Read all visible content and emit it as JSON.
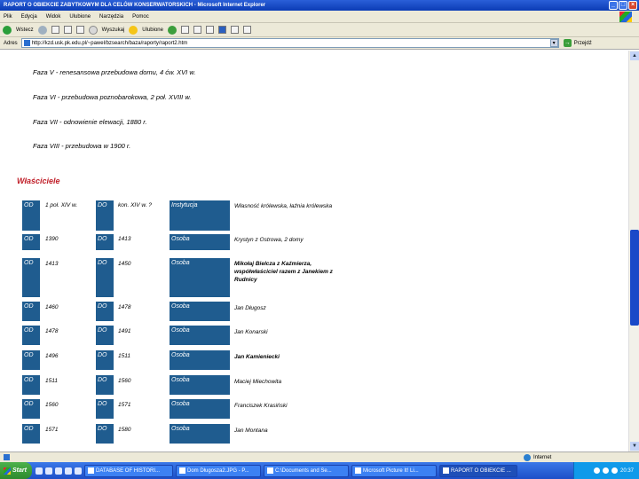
{
  "window": {
    "title": "RAPORT O OBIEKCIE ZABYTKOWYM DLA CELÓW KONSERWATORSKICH - Microsoft Internet Explorer"
  },
  "menu": [
    "Plik",
    "Edycja",
    "Widok",
    "Ulubione",
    "Narzędzia",
    "Pomoc"
  ],
  "toolbar": {
    "back": "Wstecz",
    "search": "Wyszukaj",
    "favorites": "Ulubione"
  },
  "address": {
    "label": "Adres",
    "url": "http://kzd.usk.pk.edu.pl/~pawel/bzsearch/baza/raporty/raport2.htm",
    "go": "Przejdź"
  },
  "phases": [
    "Faza V - renesansowa przebudowa domu, 4 ćw. XVI w.",
    "Faza VI - przebudowa poznobarokowa, 2 poł. XVIII w.",
    "Faza VII - odnowienie elewacji, 1880 r.",
    "Faza VIII - przebudowa w 1900 r."
  ],
  "owners_heading": "Właściciele",
  "owners": [
    {
      "od_label": "OD",
      "od": "1 poł. XIV w.",
      "do_label": "DO",
      "do": "kon. XIV w. ?",
      "type": "Instytucja",
      "desc": "Własność królewska, łaźnia królewska"
    },
    {
      "od_label": "OD",
      "od": "1390",
      "do_label": "DO",
      "do": "1413",
      "type": "Osoba",
      "desc": "Krystyn z Ostrowa, 2 domy"
    },
    {
      "od_label": "OD",
      "od": "1413",
      "do_label": "DO",
      "do": "1450",
      "type": "Osoba",
      "desc": "Mikołaj Bielcza z Kaźmierza, współwłaściciel razem z Janekiem z Rudnicy"
    },
    {
      "od_label": "OD",
      "od": "1460",
      "do_label": "DO",
      "do": "1478",
      "type": "Osoba",
      "desc": "Jan Długosz"
    },
    {
      "od_label": "OD",
      "od": "1478",
      "do_label": "DO",
      "do": "1491",
      "type": "Osoba",
      "desc": "Jan Konarski"
    },
    {
      "od_label": "OD",
      "od": "1496",
      "do_label": "DO",
      "do": "1511",
      "type": "Osoba",
      "desc": "Jan Kamieniecki"
    },
    {
      "od_label": "OD",
      "od": "1511",
      "do_label": "DO",
      "do": "1560",
      "type": "Osoba",
      "desc": "Maciej Miechowita"
    },
    {
      "od_label": "OD",
      "od": "1560",
      "do_label": "DO",
      "do": "1571",
      "type": "Osoba",
      "desc": "Franciszek Krasiński"
    },
    {
      "od_label": "OD",
      "od": "1571",
      "do_label": "DO",
      "do": "1580",
      "type": "Osoba",
      "desc": "Jan Montana"
    }
  ],
  "status": {
    "zone": "Internet"
  },
  "taskbar": {
    "start": "Start",
    "tasks": [
      "DATABASE OF HISTORI...",
      "Dom Długosza2.JPG - P...",
      "C:\\Documents and Se...",
      "Microsoft Picture It! Li...",
      "RAPORT O OBIEKCIE ..."
    ],
    "clock": "20:37"
  }
}
